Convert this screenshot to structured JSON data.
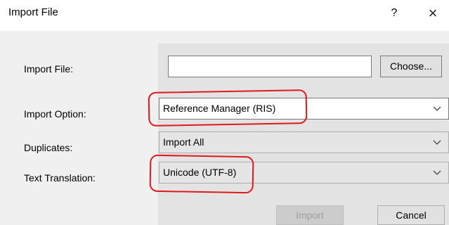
{
  "window": {
    "title": "Import File",
    "help_glyph": "?",
    "close_glyph": "×"
  },
  "form": {
    "import_file_label": "Import File:",
    "import_file_value": "",
    "choose_label": "Choose...",
    "import_option_label": "Import Option:",
    "import_option_value": "Reference Manager (RIS)",
    "duplicates_label": "Duplicates:",
    "duplicates_value": "Import All",
    "text_translation_label": "Text Translation:",
    "text_translation_value": "Unicode (UTF-8)"
  },
  "buttons": {
    "import_label": "Import",
    "import_enabled": false,
    "cancel_label": "Cancel"
  },
  "annotations": {
    "color": "#e0191d",
    "circled": [
      "Reference Manager (RIS)",
      "Unicode (UTF-8)"
    ]
  },
  "icons": {
    "dropdown": "chevron-down-icon",
    "close": "close-icon",
    "help": "help-icon"
  }
}
